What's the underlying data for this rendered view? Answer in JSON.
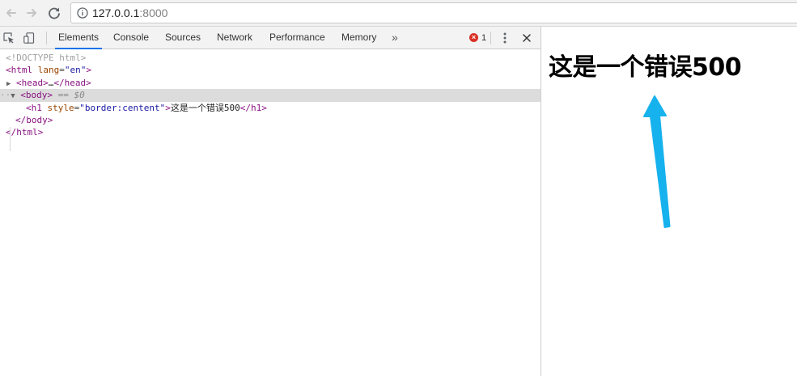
{
  "browser": {
    "url_host": "127.0.0.1",
    "url_port": ":8000"
  },
  "devtools": {
    "tabs": [
      "Elements",
      "Console",
      "Sources",
      "Network",
      "Performance",
      "Memory"
    ],
    "active_tab": "Elements",
    "more_tabs": "»",
    "error_count": "1",
    "close_label": "✕"
  },
  "elements_tree": {
    "doctype": "<!DOCTYPE html>",
    "html_open_tag": "html",
    "html_lang_attr": "lang",
    "html_lang_value": "en",
    "head_collapsed": "head",
    "head_ellipsis": "…",
    "body_tag": "body",
    "body_selected_suffix": "== $0",
    "h1_tag": "h1",
    "h1_style_attr": "style",
    "h1_style_value": "border:centent",
    "h1_text": "这是一个错误500",
    "body_close": "/body",
    "html_close": "/html"
  },
  "page": {
    "heading": "这是一个错误500"
  },
  "colors": {
    "devtools_accent": "#1a73e8",
    "error_red": "#d93025",
    "annotation_arrow": "#16b2ee"
  },
  "icons": [
    "back-arrow-icon",
    "forward-arrow-icon",
    "reload-icon",
    "info-icon",
    "inspect-element-icon",
    "device-toolbar-icon",
    "error-icon",
    "kebab-menu-icon",
    "close-icon"
  ]
}
